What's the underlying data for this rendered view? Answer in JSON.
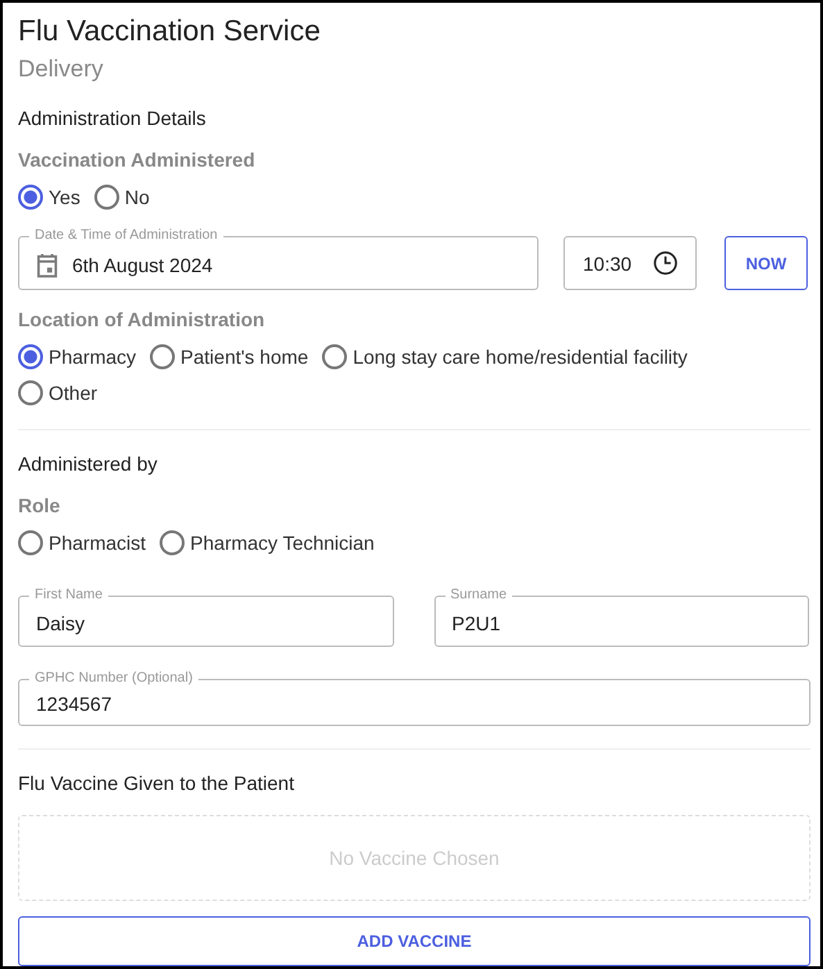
{
  "title": "Flu Vaccination Service",
  "subtitle": "Delivery",
  "administration": {
    "heading": "Administration Details",
    "administered": {
      "label": "Vaccination Administered",
      "options": [
        {
          "label": "Yes",
          "selected": true
        },
        {
          "label": "No",
          "selected": false
        }
      ]
    },
    "date_field": {
      "label": "Date & Time of Administration",
      "value": "6th August 2024"
    },
    "time_field": {
      "value": "10:30"
    },
    "now_button": "NOW",
    "location": {
      "label": "Location of Administration",
      "options": [
        {
          "label": "Pharmacy",
          "selected": true
        },
        {
          "label": "Patient's home",
          "selected": false
        },
        {
          "label": "Long stay care home/residential facility",
          "selected": false
        },
        {
          "label": "Other",
          "selected": false
        }
      ]
    }
  },
  "administered_by": {
    "heading": "Administered by",
    "role": {
      "label": "Role",
      "options": [
        {
          "label": "Pharmacist",
          "selected": false
        },
        {
          "label": "Pharmacy Technician",
          "selected": false
        }
      ]
    },
    "first_name": {
      "label": "First Name",
      "value": "Daisy"
    },
    "surname": {
      "label": "Surname",
      "value": "P2U1"
    },
    "gphc": {
      "label": "GPHC Number (Optional)",
      "value": "1234567"
    }
  },
  "vaccine": {
    "heading": "Flu Vaccine Given to the Patient",
    "empty_text": "No Vaccine Chosen",
    "add_button": "ADD VACCINE"
  }
}
